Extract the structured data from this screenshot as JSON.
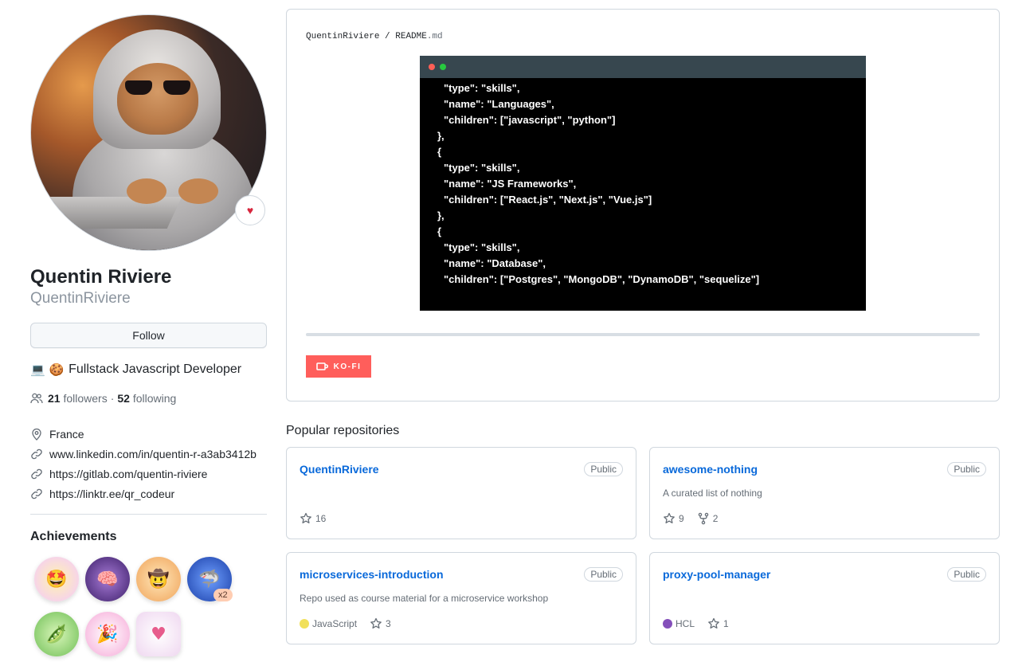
{
  "profile": {
    "name": "Quentin Riviere",
    "login": "QuentinRiviere",
    "follow_label": "Follow",
    "bio_emoji": "💻 🍪",
    "bio": "Fullstack Javascript Developer",
    "followers_count": "21",
    "followers_label": "followers",
    "separator": "·",
    "following_count": "52",
    "following_label": "following",
    "location": "France",
    "links": [
      "www.linkedin.com/in/quentin-r-a3ab3412b",
      "https://gitlab.com/quentin-riviere",
      "https://linktr.ee/qr_codeur"
    ],
    "achievements_title": "Achievements",
    "achievements": [
      {
        "icon": "star-struck-badge",
        "glyph": "🤩",
        "color": "#f3c7ff"
      },
      {
        "icon": "galaxy-brain-badge",
        "glyph": "🧠",
        "color": "#6b3fa0"
      },
      {
        "icon": "yolo-cowboy-badge",
        "glyph": "🤠",
        "color": "#f8c98a"
      },
      {
        "icon": "shark-badge",
        "glyph": "🦈",
        "color": "#2f5fd0",
        "count": "x2"
      },
      {
        "icon": "pair-extraordinaire-badge",
        "glyph": "🫛",
        "color": "#a8dc8c"
      },
      {
        "icon": "yolo-badge",
        "glyph": "🎉",
        "color": "#fbc2e6"
      },
      {
        "icon": "heart-on-sleeve-badge",
        "glyph": "♥",
        "color": "#f7d6e6"
      }
    ],
    "avatar_heart": "♥"
  },
  "readme": {
    "owner": "QuentinRiviere",
    "sep": "/",
    "file": "README",
    "ext": ".md",
    "terminal_lines": [
      "\"type\": \"skills\",",
      "\"name\": \"Languages\",",
      "\"children\": [\"javascript\", \"python\"]",
      "},",
      "{",
      "\"type\": \"skills\",",
      "\"name\": \"JS Frameworks\",",
      "\"children\": [\"React.js\", \"Next.js\", \"Vue.js\"]",
      "},",
      "{",
      "\"type\": \"skills\",",
      "\"name\": \"Database\",",
      "\"children\": [\"Postgres\", \"MongoDB\", \"DynamoDB\", \"sequelize\"]"
    ],
    "kofi_label": "KO-FI"
  },
  "popular": {
    "title": "Popular repositories",
    "repos": [
      {
        "name": "QuentinRiviere",
        "visibility": "Public",
        "description": "",
        "language": "",
        "lang_color": "",
        "stars": "16",
        "forks": ""
      },
      {
        "name": "awesome-nothing",
        "visibility": "Public",
        "description": "A curated list of nothing",
        "language": "",
        "lang_color": "",
        "stars": "9",
        "forks": "2"
      },
      {
        "name": "microservices-introduction",
        "visibility": "Public",
        "description": "Repo used as course material for a microservice workshop",
        "language": "JavaScript",
        "lang_color": "#f1e05a",
        "stars": "3",
        "forks": ""
      },
      {
        "name": "proxy-pool-manager",
        "visibility": "Public",
        "description": "",
        "language": "HCL",
        "lang_color": "#844fba",
        "stars": "1",
        "forks": ""
      }
    ]
  },
  "colors": {
    "link": "#0969da",
    "kofi": "#ff5e5b",
    "terminal_bar": "#37474f",
    "term_dot_red": "#ff5f56",
    "term_dot_green": "#27c93f"
  }
}
